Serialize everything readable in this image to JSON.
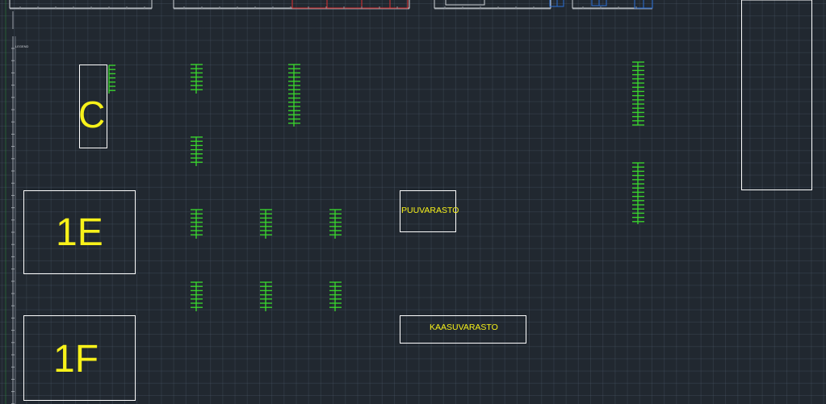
{
  "zones": {
    "c_label": "C",
    "e1_label": "1E",
    "f1_label": "1F",
    "wood_storage_label": "PUUVARASTO",
    "gas_storage_label": "KAASUVARASTO"
  },
  "ruler_tag": "LEGEND",
  "colors": {
    "background": "#212830",
    "outline": "#ffffff",
    "label": "#f7f11a",
    "rack": "#39d12d",
    "red_linework": "#e0302f",
    "blue_linework": "#2b6fd6"
  }
}
